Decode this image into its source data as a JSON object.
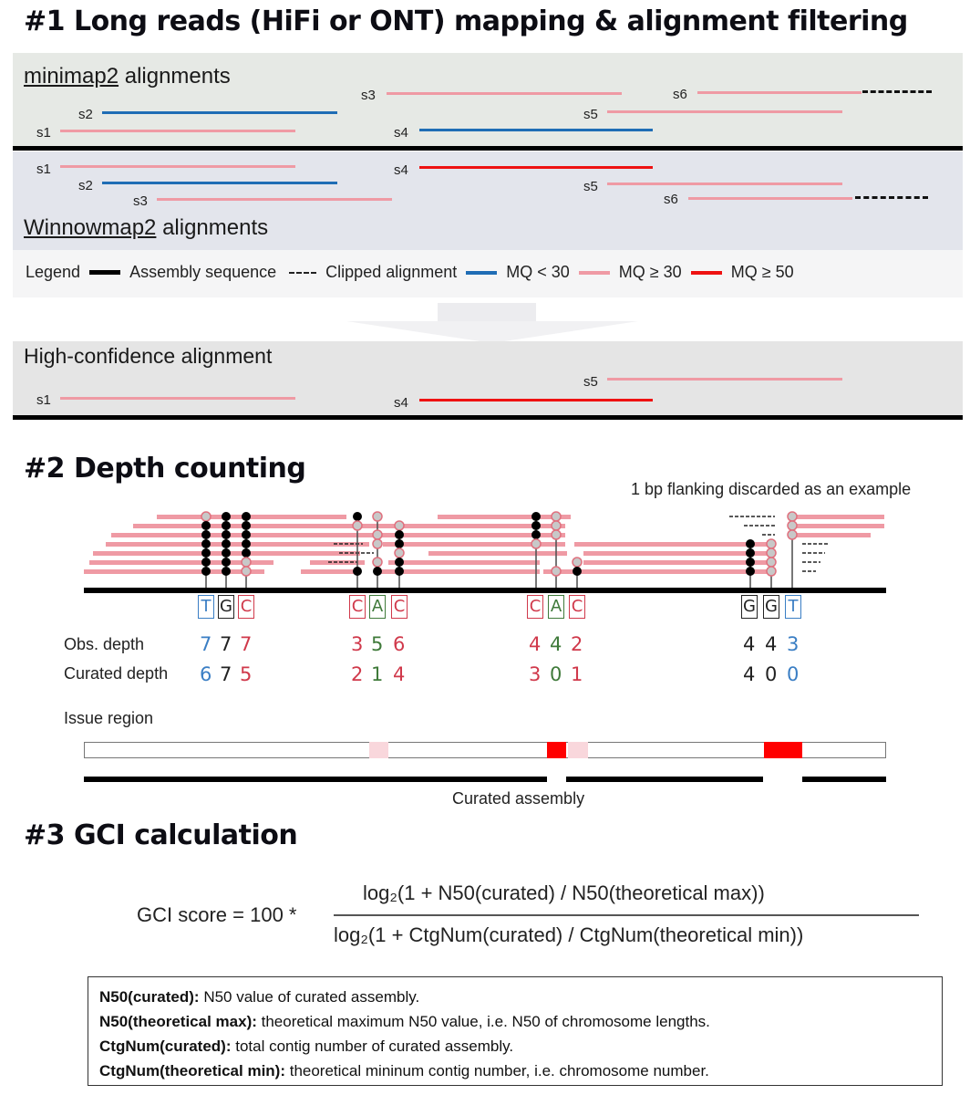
{
  "section1": {
    "title": "#1 Long reads (HiFi or ONT) mapping & alignment filtering",
    "minimap": {
      "tool": "minimap2",
      "suffix": " alignments",
      "reads": [
        {
          "id": "s1",
          "mq_class": "MQ ≥ 30",
          "clipped": false
        },
        {
          "id": "s2",
          "mq_class": "MQ < 30",
          "clipped": false
        },
        {
          "id": "s3",
          "mq_class": "MQ ≥ 30",
          "clipped": false
        },
        {
          "id": "s4",
          "mq_class": "MQ < 30",
          "clipped": false
        },
        {
          "id": "s5",
          "mq_class": "MQ ≥ 30",
          "clipped": false
        },
        {
          "id": "s6",
          "mq_class": "MQ ≥ 30",
          "clipped": true
        }
      ]
    },
    "winnowmap": {
      "tool": "Winnowmap2",
      "suffix": " alignments",
      "reads": [
        {
          "id": "s1",
          "mq_class": "MQ ≥ 30",
          "clipped": false
        },
        {
          "id": "s2",
          "mq_class": "MQ < 30",
          "clipped": false
        },
        {
          "id": "s3",
          "mq_class": "MQ ≥ 30",
          "clipped": false
        },
        {
          "id": "s4",
          "mq_class": "MQ ≥ 50",
          "clipped": false
        },
        {
          "id": "s5",
          "mq_class": "MQ ≥ 30",
          "clipped": false
        },
        {
          "id": "s6",
          "mq_class": "MQ ≥ 30",
          "clipped": true
        }
      ]
    },
    "legend": {
      "title": "Legend",
      "items": [
        {
          "label": "Assembly sequence",
          "style": "solid",
          "color": "#000000"
        },
        {
          "label": "Clipped alignment",
          "style": "dashed",
          "color": "#222222"
        },
        {
          "label": "MQ < 30",
          "style": "solid",
          "color": "#1f6db5"
        },
        {
          "label": "MQ ≥ 30",
          "style": "solid",
          "color": "#ef9aa4"
        },
        {
          "label": "MQ ≥ 50",
          "style": "solid",
          "color": "#ee1111"
        }
      ]
    },
    "high_confidence": {
      "title": "High-confidence alignment",
      "reads": [
        {
          "id": "s1",
          "mq_class": "MQ ≥ 30"
        },
        {
          "id": "s4",
          "mq_class": "MQ ≥ 50"
        },
        {
          "id": "s5",
          "mq_class": "MQ ≥ 30"
        }
      ]
    }
  },
  "section2": {
    "title": "#2 Depth counting",
    "note": "1 bp flanking discarded as an example",
    "row_labels": {
      "obs": "Obs. depth",
      "curated": "Curated depth"
    },
    "groups": [
      {
        "bases": [
          {
            "base": "T",
            "color": "#3a7ec4",
            "obs": "7",
            "curated": "6"
          },
          {
            "base": "G",
            "color": "#222222",
            "obs": "7",
            "curated": "7"
          },
          {
            "base": "C",
            "color": "#d0394b",
            "obs": "7",
            "curated": "5"
          }
        ]
      },
      {
        "bases": [
          {
            "base": "C",
            "color": "#d0394b",
            "obs": "3",
            "curated": "2"
          },
          {
            "base": "A",
            "color": "#3f7a3a",
            "obs": "5",
            "curated": "1"
          },
          {
            "base": "C",
            "color": "#d0394b",
            "obs": "6",
            "curated": "4"
          }
        ]
      },
      {
        "bases": [
          {
            "base": "C",
            "color": "#d0394b",
            "obs": "4",
            "curated": "3"
          },
          {
            "base": "A",
            "color": "#3f7a3a",
            "obs": "4",
            "curated": "0"
          },
          {
            "base": "C",
            "color": "#d0394b",
            "obs": "2",
            "curated": "1"
          }
        ]
      },
      {
        "bases": [
          {
            "base": "G",
            "color": "#222222",
            "obs": "4",
            "curated": "4"
          },
          {
            "base": "G",
            "color": "#222222",
            "obs": "4",
            "curated": "0"
          },
          {
            "base": "T",
            "color": "#3a7ec4",
            "obs": "3",
            "curated": "0"
          }
        ]
      }
    ],
    "issue_region_label": "Issue region",
    "curated_assembly_label": "Curated assembly"
  },
  "section3": {
    "title": "#3 GCI calculation",
    "formula": {
      "lhs": "GCI score = 100 *",
      "numerator": "log₂(1 + N50(curated) / N50(theoretical max))",
      "denominator": "log₂(1 + CtgNum(curated) / CtgNum(theoretical min))"
    },
    "definitions": [
      {
        "term": "N50(curated):",
        "text": " N50 value of curated assembly."
      },
      {
        "term": "N50(theoretical max):",
        "text": " theoretical maximum N50 value, i.e. N50 of chromosome lengths."
      },
      {
        "term": "CtgNum(curated):",
        "text": " total contig number of curated assembly."
      },
      {
        "term": "CtgNum(theoretical min):",
        "text": " theoretical mininum contig number, i.e. chromosome number."
      }
    ]
  }
}
